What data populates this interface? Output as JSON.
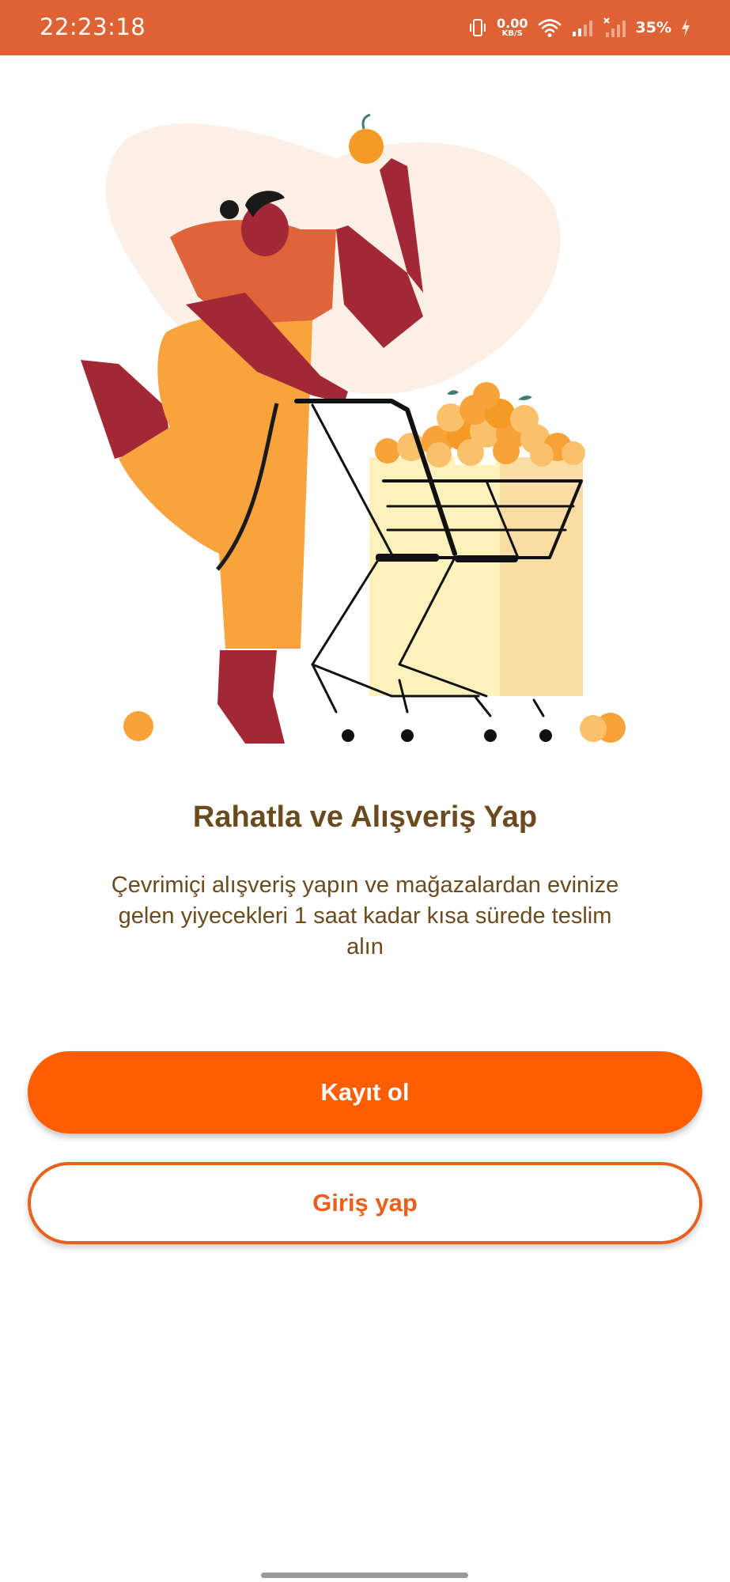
{
  "status_bar": {
    "time": "22:23:18",
    "net_speed_value": "0.00",
    "net_speed_unit": "KB/S",
    "battery": "35%",
    "icons": [
      "vibrate-icon",
      "wifi-icon",
      "signal-icon",
      "signal-no-sim-icon",
      "charging-icon"
    ]
  },
  "onboarding": {
    "illustration": "woman-with-shopping-cart-and-oranges",
    "title": "Rahatla ve Alışveriş Yap",
    "description": "Çevrimiçi alışveriş yapın ve mağazalardan evinize gelen yiyecekleri 1 saat kadar kısa sürede teslim alın"
  },
  "actions": {
    "register_label": "Kayıt ol",
    "login_label": "Giriş yap"
  },
  "colors": {
    "status_bar": "#DF6234",
    "primary": "#FF5E00",
    "outline": "#E8611C",
    "text": "#6B4A1E"
  }
}
